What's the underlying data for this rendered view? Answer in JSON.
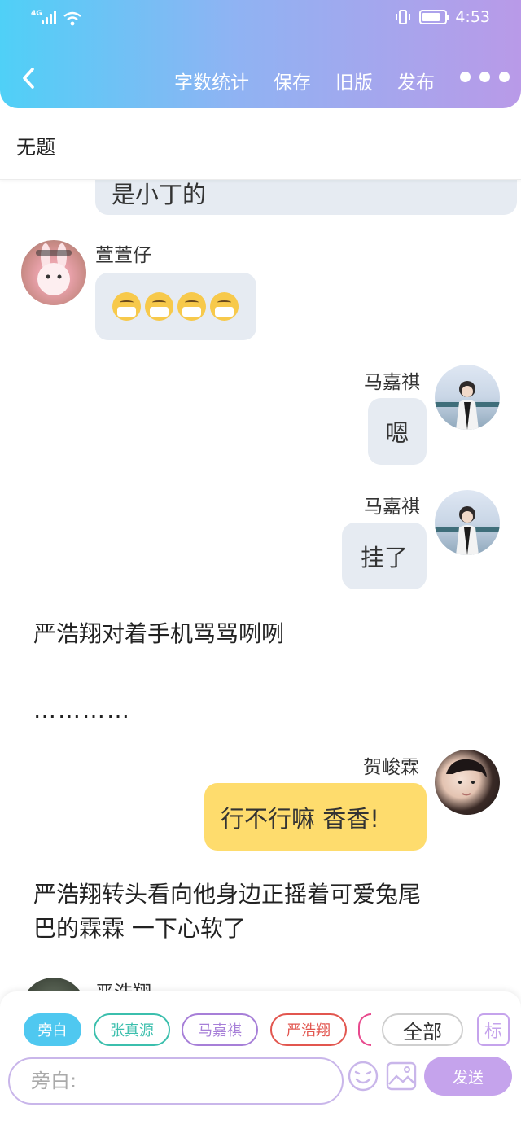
{
  "status_bar": {
    "network": "4G",
    "time": "4:53"
  },
  "nav": {
    "actions": [
      "字数统计",
      "保存",
      "旧版",
      "发布"
    ]
  },
  "document": {
    "title": "无题"
  },
  "messages": [
    {
      "type": "bubble_partial",
      "text": "是小丁的"
    },
    {
      "type": "left",
      "name": "萱萱仔",
      "content": "emoji",
      "emoji_count": 4
    },
    {
      "type": "right",
      "name": "马嘉祺",
      "text": "嗯"
    },
    {
      "type": "right",
      "name": "马嘉祺",
      "text": "挂了"
    },
    {
      "type": "narration",
      "text": "严浩翔对着手机骂骂咧咧"
    },
    {
      "type": "narration",
      "text": "…………"
    },
    {
      "type": "right",
      "name": "贺峻霖",
      "text": "行不行嘛 香香!"
    },
    {
      "type": "narration",
      "text": "严浩翔转头看向他身边正摇着可爱兔尾巴的霖霖 一下心软了"
    },
    {
      "type": "left_partial",
      "name": "严浩翔"
    }
  ],
  "narration_lines": {
    "line1": "严浩翔转头看向他身边正摇着可爱兔尾",
    "line2": "巴的霖霖 一下心软了"
  },
  "role_chips": [
    {
      "label": "旁白",
      "color": "#4fc8f0",
      "active": true
    },
    {
      "label": "张真源",
      "color": "#3bbfad",
      "active": false
    },
    {
      "label": "马嘉祺",
      "color": "#a77fd8",
      "active": false
    },
    {
      "label": "严浩翔",
      "color": "#e2564f",
      "active": false
    }
  ],
  "all_button": "全部",
  "tag_button": "标",
  "input": {
    "placeholder": "旁白:"
  },
  "send_label": "发送"
}
